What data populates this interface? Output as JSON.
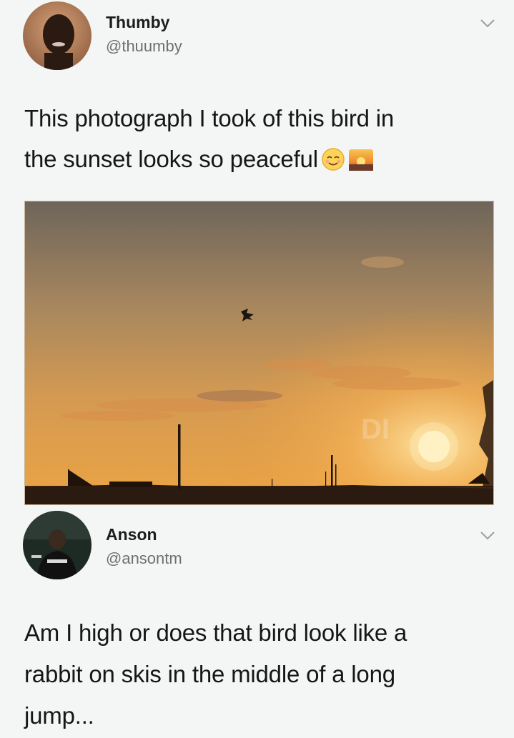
{
  "tweets": [
    {
      "name": "Thumby",
      "handle": "@thuumby",
      "text_lines": [
        "This photograph I took of this bird in",
        "the sunset looks so peaceful"
      ],
      "emojis": [
        "relieved-face-icon",
        "sunset-icon"
      ],
      "photo": {
        "watermark": "DI"
      }
    },
    {
      "name": "Anson",
      "handle": "@ansontm",
      "text_lines": [
        "Am I high or does that bird look like a",
        "rabbit on skis in the middle of a long",
        "jump..."
      ]
    }
  ],
  "colors": {
    "background": "#f4f6f5",
    "handle": "#6d6f72",
    "sky_top": "#6e655a",
    "sky_mid": "#c79a5e",
    "sky_low": "#e7a44e",
    "sun": "#fff2c4"
  }
}
